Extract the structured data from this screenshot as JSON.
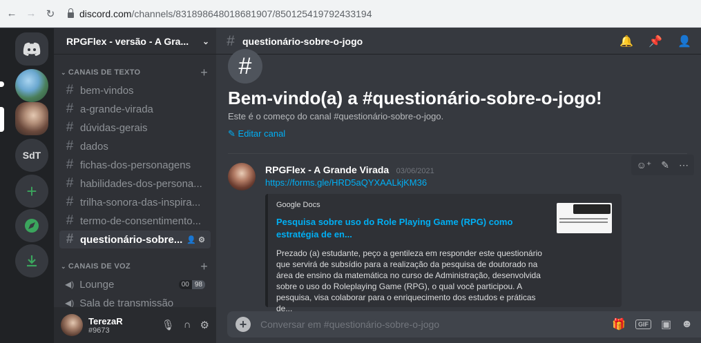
{
  "browser": {
    "url_host": "discord.com",
    "url_path": "/channels/831898648018681907/850125419792433194"
  },
  "guilds": {
    "initials": "SdT"
  },
  "sidebar": {
    "server_name": "RPGFlex - versão - A Gra...",
    "text_category": "CANAIS DE TEXTO",
    "voice_category": "CANAIS DE VOZ",
    "text_channels": [
      "bem-vindos",
      "a-grande-virada",
      "dúvidas-gerais",
      "dados",
      "fichas-dos-personagens",
      "habilidades-dos-persona...",
      "trilha-sonora-das-inspira...",
      "termo-de-consentimento...",
      "questionário-sobre..."
    ],
    "voice_channels": [
      {
        "name": "Lounge",
        "badge_left": "00",
        "badge_right": "98"
      },
      {
        "name": "Sala de transmissão"
      }
    ]
  },
  "user": {
    "name": "TerezaR",
    "tag": "#9673"
  },
  "header": {
    "channel_name": "questionário-sobre-o-jogo"
  },
  "welcome": {
    "title": "Bem-vindo(a) a #questionário-sobre-o-jogo!",
    "subtitle": "Este é o começo do canal #questionário-sobre-o-jogo.",
    "edit_label": "Editar canal"
  },
  "message": {
    "author": "RPGFlex - A Grande Virada",
    "timestamp": "03/06/2021",
    "link": "https://forms.gle/HRD5aQYXAALkjKM36",
    "embed": {
      "provider": "Google Docs",
      "title": "Pesquisa sobre uso do Role Playing Game (RPG) como estratégia de en...",
      "description": "Prezado (a) estudante, peço a gentileza em responder este questionário que servirá de subsídio para a realização da pesquisa de doutorado na área de ensino da matemática no curso de Administração, desenvolvida sobre o uso do Roleplaying Game (RPG), o qual você participou. A pesquisa, visa colaborar para o enriquecimento dos estudos e práticas de..."
    }
  },
  "composer": {
    "placeholder": "Conversar em #questionário-sobre-o-jogo",
    "gif_label": "GIF"
  }
}
